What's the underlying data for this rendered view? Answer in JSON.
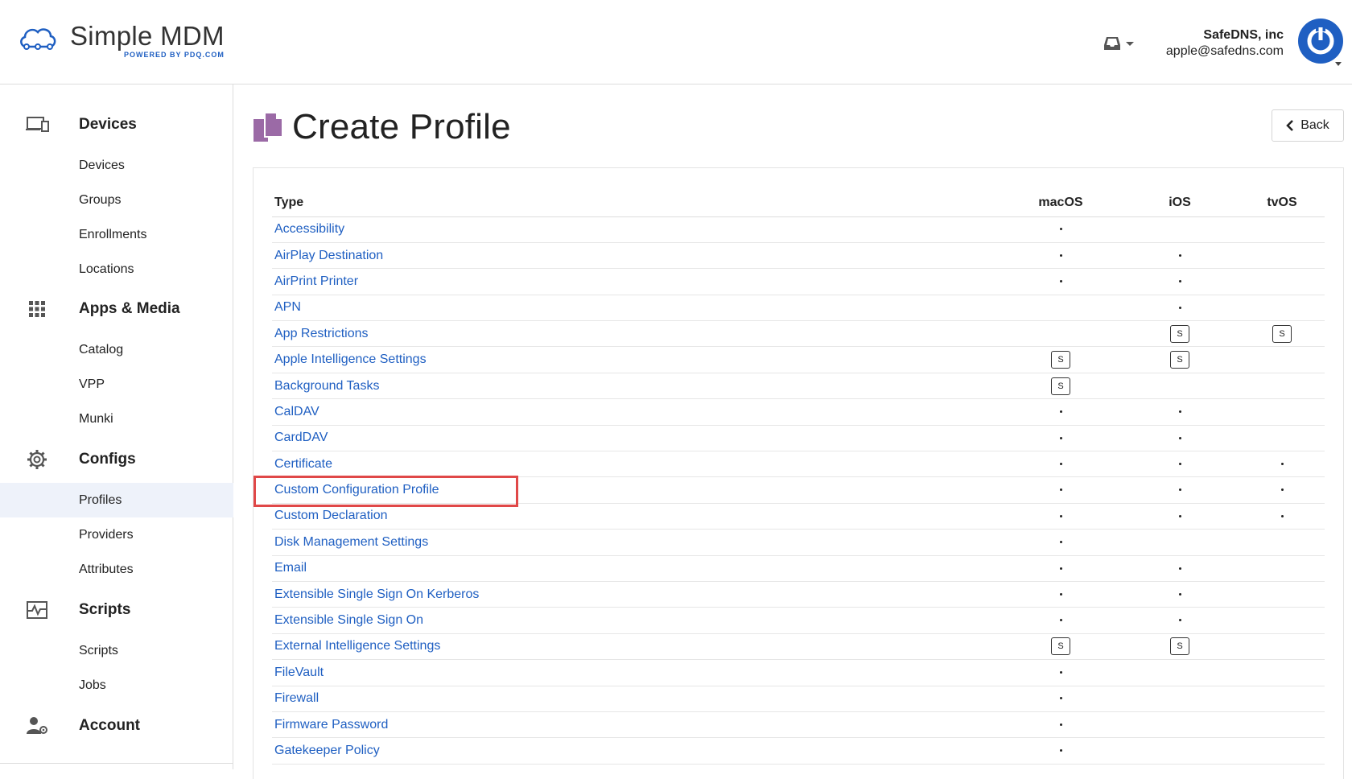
{
  "brand": {
    "name": "Simple MDM",
    "tagline": "POWERED BY PDQ.COM"
  },
  "header": {
    "org": "SafeDNS, inc",
    "email": "apple@safedns.com"
  },
  "sidebar": {
    "devices": {
      "title": "Devices",
      "items": [
        "Devices",
        "Groups",
        "Enrollments",
        "Locations"
      ]
    },
    "apps": {
      "title": "Apps & Media",
      "items": [
        "Catalog",
        "VPP",
        "Munki"
      ]
    },
    "configs": {
      "title": "Configs",
      "items": [
        "Profiles",
        "Providers",
        "Attributes"
      ]
    },
    "scripts": {
      "title": "Scripts",
      "items": [
        "Scripts",
        "Jobs"
      ]
    },
    "account": {
      "title": "Account"
    }
  },
  "page": {
    "title": "Create Profile",
    "back_label": "Back"
  },
  "table": {
    "headers": [
      "Type",
      "macOS",
      "iOS",
      "tvOS"
    ],
    "rows": [
      {
        "type": "Accessibility",
        "macos": "dot",
        "ios": "",
        "tvos": ""
      },
      {
        "type": "AirPlay Destination",
        "macos": "dot",
        "ios": "dot",
        "tvos": ""
      },
      {
        "type": "AirPrint Printer",
        "macos": "dot",
        "ios": "dot",
        "tvos": ""
      },
      {
        "type": "APN",
        "macos": "",
        "ios": "dot",
        "tvos": ""
      },
      {
        "type": "App Restrictions",
        "macos": "",
        "ios": "S",
        "tvos": "S"
      },
      {
        "type": "Apple Intelligence Settings",
        "macos": "S",
        "ios": "S",
        "tvos": ""
      },
      {
        "type": "Background Tasks",
        "macos": "S",
        "ios": "",
        "tvos": ""
      },
      {
        "type": "CalDAV",
        "macos": "dot",
        "ios": "dot",
        "tvos": ""
      },
      {
        "type": "CardDAV",
        "macos": "dot",
        "ios": "dot",
        "tvos": ""
      },
      {
        "type": "Certificate",
        "macos": "dot",
        "ios": "dot",
        "tvos": "dot"
      },
      {
        "type": "Custom Configuration Profile",
        "macos": "dot",
        "ios": "dot",
        "tvos": "dot"
      },
      {
        "type": "Custom Declaration",
        "macos": "dot",
        "ios": "dot",
        "tvos": "dot"
      },
      {
        "type": "Disk Management Settings",
        "macos": "dot",
        "ios": "",
        "tvos": ""
      },
      {
        "type": "Email",
        "macos": "dot",
        "ios": "dot",
        "tvos": ""
      },
      {
        "type": "Extensible Single Sign On Kerberos",
        "macos": "dot",
        "ios": "dot",
        "tvos": ""
      },
      {
        "type": "Extensible Single Sign On",
        "macos": "dot",
        "ios": "dot",
        "tvos": ""
      },
      {
        "type": "External Intelligence Settings",
        "macos": "S",
        "ios": "S",
        "tvos": ""
      },
      {
        "type": "FileVault",
        "macos": "dot",
        "ios": "",
        "tvos": ""
      },
      {
        "type": "Firewall",
        "macos": "dot",
        "ios": "",
        "tvos": ""
      },
      {
        "type": "Firmware Password",
        "macos": "dot",
        "ios": "",
        "tvos": ""
      },
      {
        "type": "Gatekeeper Policy",
        "macos": "dot",
        "ios": "",
        "tvos": ""
      }
    ]
  },
  "colors": {
    "link": "#1f5fc2",
    "brand_blue": "#1f5fc2",
    "highlight": "#e04848",
    "active_nav_bg": "#eef2fa",
    "profile_icon": "#9b6aa6"
  },
  "icons": {
    "logo": "cloud-network-icon",
    "inbox": "inbox-tray-icon",
    "avatar": "power-icon",
    "devices": "devices-icon",
    "apps": "grid-icon",
    "configs": "gear-icon",
    "scripts": "scripts-icon",
    "account": "user-gear-icon",
    "page": "profile-document-icon",
    "back": "chevron-left-icon"
  }
}
